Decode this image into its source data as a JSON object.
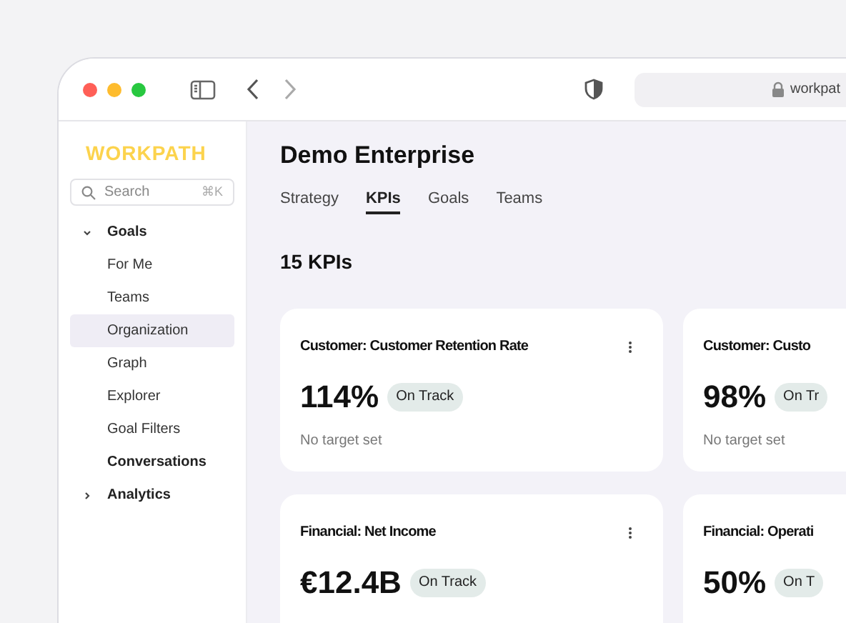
{
  "browser": {
    "url": "workpat"
  },
  "sidebar": {
    "logo": "WORKPATH",
    "search": {
      "placeholder": "Search",
      "shortcut": "⌘K"
    },
    "items": [
      {
        "label": "Goals",
        "kind": "group",
        "expanded": true,
        "selected": false,
        "children": [
          {
            "label": "For Me",
            "kind": "item",
            "selected": false
          },
          {
            "label": "Teams",
            "kind": "item",
            "selected": false
          },
          {
            "label": "Organization",
            "kind": "item",
            "selected": true
          },
          {
            "label": "Graph",
            "kind": "item",
            "selected": false
          },
          {
            "label": "Explorer",
            "kind": "item",
            "selected": false
          },
          {
            "label": "Goal Filters",
            "kind": "item",
            "selected": false
          }
        ]
      },
      {
        "label": "Conversations",
        "kind": "section",
        "selected": false
      },
      {
        "label": "Analytics",
        "kind": "group",
        "expanded": false,
        "selected": false
      }
    ]
  },
  "page": {
    "title": "Demo Enterprise",
    "tabs": [
      {
        "label": "Strategy",
        "selected": false
      },
      {
        "label": "KPIs",
        "selected": true
      },
      {
        "label": "Goals",
        "selected": false
      },
      {
        "label": "Teams",
        "selected": false
      }
    ],
    "count": "15 KPIs",
    "cards": [
      {
        "title": "Customer: Customer Retention Rate",
        "value": "114%",
        "status": "On Track",
        "note": "No target set"
      },
      {
        "title": "Customer: Custo",
        "value": "98%",
        "status": "On Tr",
        "note": "No target set"
      },
      {
        "title": "Financial: Net Income",
        "value": "€12.4B",
        "status": "On Track"
      },
      {
        "title": "Financial: Operati",
        "value": "50%",
        "status": "On T"
      }
    ]
  }
}
